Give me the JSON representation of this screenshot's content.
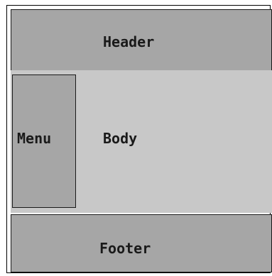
{
  "diagram": {
    "header": {
      "label": "Header"
    },
    "menu": {
      "label": "Menu"
    },
    "body": {
      "label": "Body"
    },
    "footer": {
      "label": "Footer"
    }
  },
  "colors": {
    "header_fill": "#a6a6a6",
    "menu_fill": "#a6a6a6",
    "body_fill": "#c8c8c8",
    "footer_fill": "#a6a6a6",
    "border": "#1a1a1a"
  }
}
